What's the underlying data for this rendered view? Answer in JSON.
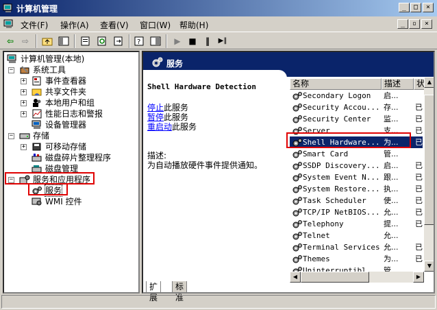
{
  "window": {
    "title": "计算机管理",
    "buttons": {
      "minimize": "_",
      "maximize": "□",
      "close": "×"
    }
  },
  "menu": {
    "items": [
      "文件(F)",
      "操作(A)",
      "查看(V)",
      "窗口(W)",
      "帮助(H)"
    ],
    "mdi_buttons": {
      "minimize": "_",
      "restore": "▫",
      "close": "×"
    }
  },
  "tree": {
    "root": "计算机管理(本地)",
    "system_tools": "系统工具",
    "event_viewer": "事件查看器",
    "shared_folders": "共享文件夹",
    "local_users": "本地用户和组",
    "perf_logs": "性能日志和警报",
    "device_manager": "设备管理器",
    "storage": "存储",
    "removable_storage": "可移动存储",
    "defrag": "磁盘碎片整理程序",
    "disk_management": "磁盘管理",
    "services_apps": "服务和应用程序",
    "services": "服务",
    "wmi": "WMI 控件",
    "expanders": {
      "root": "−",
      "system_tools": "−",
      "event_viewer": "+",
      "shared_folders": "+",
      "local_users": "+",
      "perf_logs": "+",
      "storage": "−",
      "removable_storage": "+",
      "services_apps": "−"
    }
  },
  "right_header": {
    "title": "服务"
  },
  "detail": {
    "service_name": "Shell Hardware Detection",
    "stop_link": "停止",
    "stop_rest": "此服务",
    "pause_link": "暂停",
    "pause_rest": "此服务",
    "restart_link": "重启动",
    "restart_rest": "此服务",
    "desc_label": "描述:",
    "desc_text": "为自动播放硬件事件提供通知。"
  },
  "services_table": {
    "columns": [
      "名称",
      "描述",
      "状"
    ],
    "rows": [
      {
        "name": "Secondary Logon",
        "desc": "启...",
        "status": ""
      },
      {
        "name": "Security Accou...",
        "desc": "存...",
        "status": "已"
      },
      {
        "name": "Security Center",
        "desc": "监...",
        "status": "已"
      },
      {
        "name": "Server",
        "desc": "支...",
        "status": "已"
      },
      {
        "name": "Shell Hardware...",
        "desc": "为...",
        "status": "已"
      },
      {
        "name": "Smart Card",
        "desc": "管...",
        "status": ""
      },
      {
        "name": "SSDP Discovery...",
        "desc": "启...",
        "status": "已"
      },
      {
        "name": "System Event N...",
        "desc": "跟...",
        "status": "已"
      },
      {
        "name": "System Restore...",
        "desc": "执...",
        "status": "已"
      },
      {
        "name": "Task Scheduler",
        "desc": "使...",
        "status": "已"
      },
      {
        "name": "TCP/IP NetBIOS...",
        "desc": "允...",
        "status": "已"
      },
      {
        "name": "Telephony",
        "desc": "提...",
        "status": "已"
      },
      {
        "name": "Telnet",
        "desc": "允...",
        "status": ""
      },
      {
        "name": "Terminal Services",
        "desc": "允...",
        "status": "已"
      },
      {
        "name": "Themes",
        "desc": "为...",
        "status": "已"
      },
      {
        "name": "Uninterruptibl...",
        "desc": "管...",
        "status": ""
      }
    ]
  },
  "tabs": [
    "扩展",
    "标准"
  ],
  "scroll": {
    "up": "▲",
    "down": "▼",
    "left": "◀",
    "right": "▶"
  },
  "toolbar": {
    "back": "⇦",
    "forward": "⇨",
    "play": "▶",
    "stop": "■",
    "pause": "‖",
    "restart": "▶‖"
  },
  "colors": {
    "titlebar": "#0a246a",
    "selection": "#0a246a",
    "highlight_box": "#e00000",
    "link": "#0000ff"
  }
}
